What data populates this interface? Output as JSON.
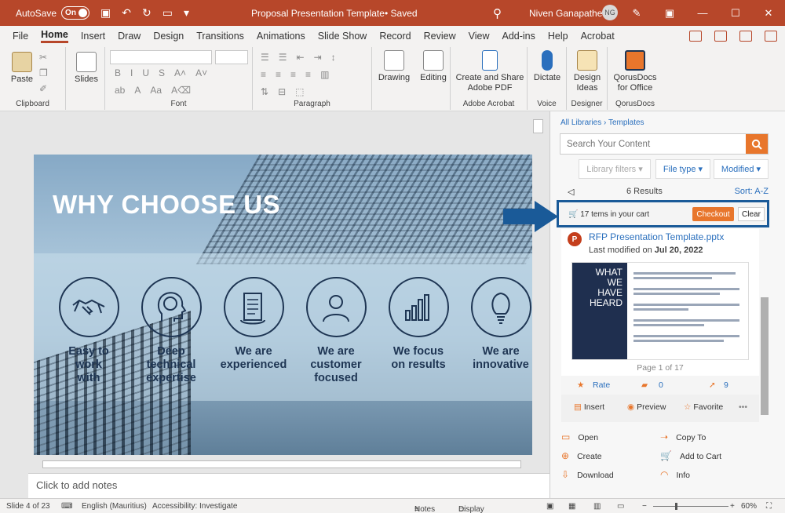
{
  "titlebar": {
    "autosave_label": "AutoSave",
    "autosave_state": "On",
    "doc_title": "Proposal Presentation Template",
    "saved_label": "• Saved",
    "user_name": "Niven Ganapathee",
    "user_initials": "NG"
  },
  "menu": {
    "tabs": [
      "File",
      "Home",
      "Insert",
      "Draw",
      "Design",
      "Transitions",
      "Animations",
      "Slide Show",
      "Record",
      "Review",
      "View",
      "Add-ins",
      "Help",
      "Acrobat"
    ],
    "active": "Home"
  },
  "ribbon": {
    "paste": "Paste",
    "clipboard": "Clipboard",
    "slides": "Slides",
    "font": "Font",
    "paragraph": "Paragraph",
    "drawing": "Drawing",
    "editing": "Editing",
    "create_share": "Create and Share",
    "adobe_pdf": "Adobe PDF",
    "adobe_acrobat": "Adobe Acrobat",
    "dictate": "Dictate",
    "voice": "Voice",
    "design_ideas_1": "Design",
    "design_ideas_2": "Ideas",
    "designer": "Designer",
    "qorus_1": "QorusDocs",
    "qorus_2": "for Office",
    "qorusdocs": "QorusDocs"
  },
  "slide": {
    "title": "WHY CHOOSE US",
    "features": [
      {
        "label": "Easy to\nwork\nwith",
        "icon": "handshake-icon"
      },
      {
        "label": "Deep\ntechnical\nexpertise",
        "icon": "brain-head-icon"
      },
      {
        "label": "We are\nexperienced",
        "icon": "scroll-icon"
      },
      {
        "label": "We are\ncustomer\nfocused",
        "icon": "person-icon"
      },
      {
        "label": "We focus\non results",
        "icon": "bar-chart-icon"
      },
      {
        "label": "We are\ninnovative",
        "icon": "lightbulb-icon"
      }
    ]
  },
  "notes_placeholder": "Click to add notes",
  "panel": {
    "crumb_root": "All Libraries",
    "crumb_current": "Templates",
    "search_placeholder": "Search Your Content",
    "filters": {
      "library": "Library filters",
      "file_type": "File type",
      "modified": "Modified"
    },
    "results": "6 Results",
    "sort": "Sort:  A-Z",
    "cart_text": "17 tems in your cart",
    "checkout": "Checkout",
    "clear": "Clear",
    "item": {
      "filename": "RFP Presentation Template.pptx",
      "modified_prefix": "Last modified on ",
      "modified_date": "Jul 20, 2022",
      "preview_heading": "WHAT\nWE\nHAVE\nHEARD",
      "page": "Page 1 of 17",
      "rate": "Rate",
      "comments": "0",
      "clicks": "9",
      "insert": "Insert",
      "preview": "Preview",
      "favorite": "Favorite",
      "more": "•••"
    },
    "menu": {
      "open": "Open",
      "copy_to": "Copy To",
      "create": "Create",
      "add_to_cart": "Add to Cart",
      "download": "Download",
      "info": "Info"
    }
  },
  "status": {
    "slide": "Slide 4 of 23",
    "language": "English (Mauritius)",
    "accessibility": "Accessibility: Investigate",
    "notes": "Notes",
    "display": "Display Settings",
    "zoom": "60%"
  },
  "colors": {
    "accent": "#b7472a",
    "orange": "#e8762c",
    "navy": "#1e3553",
    "link": "#2a6fbd"
  }
}
